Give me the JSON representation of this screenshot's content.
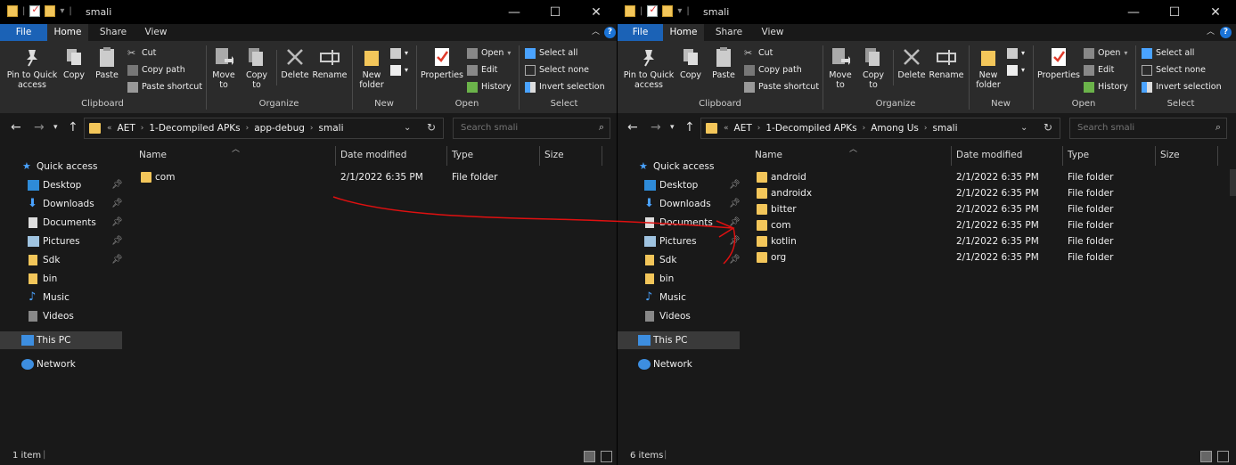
{
  "colors": {
    "accent_file_tab": "#1b62b6",
    "folder": "#f3c65a",
    "annotation_arrow": "#e01010"
  },
  "left": {
    "title": "smali",
    "window_buttons": [
      "—",
      "☐",
      "✕"
    ],
    "tabs": {
      "file": "File",
      "home": "Home",
      "share": "Share",
      "view": "View"
    },
    "ribbon": {
      "clipboard": {
        "pin_l1": "Pin to Quick",
        "pin_l2": "access",
        "copy": "Copy",
        "paste": "Paste",
        "cut": "Cut",
        "copy_path": "Copy path",
        "paste_shortcut": "Paste shortcut",
        "label": "Clipboard"
      },
      "organize": {
        "move_l1": "Move",
        "move_l2": "to",
        "copy_l1": "Copy",
        "copy_l2": "to",
        "delete": "Delete",
        "rename": "Rename",
        "label": "Organize"
      },
      "new": {
        "folder_l1": "New",
        "folder_l2": "folder",
        "label": "New"
      },
      "open": {
        "properties": "Properties",
        "open": "Open",
        "edit": "Edit",
        "history": "History",
        "label": "Open"
      },
      "select": {
        "all": "Select all",
        "none": "Select none",
        "invert": "Invert selection",
        "label": "Select"
      }
    },
    "breadcrumb": [
      "AET",
      "1-Decompiled APKs",
      "app-debug",
      "smali"
    ],
    "search_placeholder": "Search smali",
    "nav": {
      "quick_access": "Quick access",
      "items": [
        "Desktop",
        "Downloads",
        "Documents",
        "Pictures",
        "Sdk",
        "bin",
        "Music",
        "Videos"
      ],
      "this_pc": "This PC",
      "network": "Network"
    },
    "columns": {
      "name": "Name",
      "date": "Date modified",
      "type": "Type",
      "size": "Size"
    },
    "files": [
      {
        "name": "com",
        "date": "2/1/2022 6:35 PM",
        "type": "File folder"
      }
    ],
    "status": "1 item"
  },
  "right": {
    "title": "smali",
    "window_buttons": [
      "—",
      "☐",
      "✕"
    ],
    "tabs": {
      "file": "File",
      "home": "Home",
      "share": "Share",
      "view": "View"
    },
    "ribbon": {
      "clipboard": {
        "pin_l1": "Pin to Quick",
        "pin_l2": "access",
        "copy": "Copy",
        "paste": "Paste",
        "cut": "Cut",
        "copy_path": "Copy path",
        "paste_shortcut": "Paste shortcut",
        "label": "Clipboard"
      },
      "organize": {
        "move_l1": "Move",
        "move_l2": "to",
        "copy_l1": "Copy",
        "copy_l2": "to",
        "delete": "Delete",
        "rename": "Rename",
        "label": "Organize"
      },
      "new": {
        "folder_l1": "New",
        "folder_l2": "folder",
        "label": "New"
      },
      "open": {
        "properties": "Properties",
        "open": "Open",
        "edit": "Edit",
        "history": "History",
        "label": "Open"
      },
      "select": {
        "all": "Select all",
        "none": "Select none",
        "invert": "Invert selection",
        "label": "Select"
      }
    },
    "breadcrumb": [
      "AET",
      "1-Decompiled APKs",
      "Among Us",
      "smali"
    ],
    "search_placeholder": "Search smali",
    "nav": {
      "quick_access": "Quick access",
      "items": [
        "Desktop",
        "Downloads",
        "Documents",
        "Pictures",
        "Sdk",
        "bin",
        "Music",
        "Videos"
      ],
      "this_pc": "This PC",
      "network": "Network"
    },
    "columns": {
      "name": "Name",
      "date": "Date modified",
      "type": "Type",
      "size": "Size"
    },
    "files": [
      {
        "name": "android",
        "date": "2/1/2022 6:35 PM",
        "type": "File folder"
      },
      {
        "name": "androidx",
        "date": "2/1/2022 6:35 PM",
        "type": "File folder"
      },
      {
        "name": "bitter",
        "date": "2/1/2022 6:35 PM",
        "type": "File folder"
      },
      {
        "name": "com",
        "date": "2/1/2022 6:35 PM",
        "type": "File folder"
      },
      {
        "name": "kotlin",
        "date": "2/1/2022 6:35 PM",
        "type": "File folder"
      },
      {
        "name": "org",
        "date": "2/1/2022 6:35 PM",
        "type": "File folder"
      }
    ],
    "status": "6 items"
  }
}
